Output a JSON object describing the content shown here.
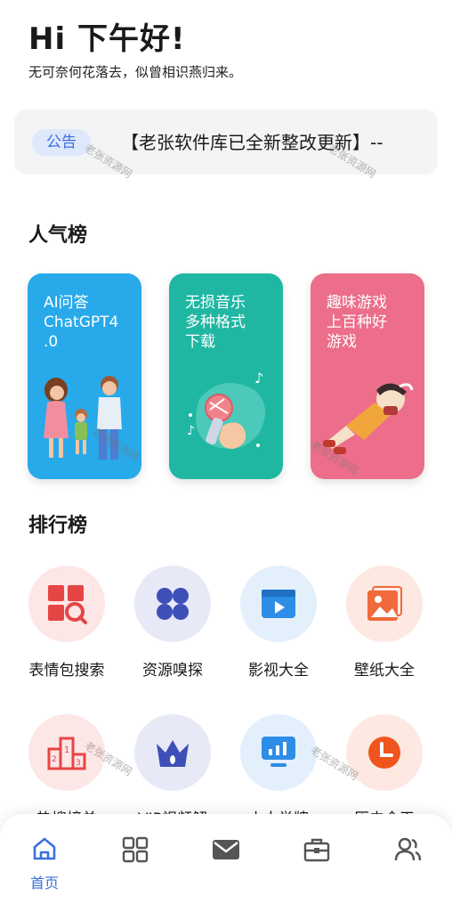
{
  "header": {
    "greeting": "Hi 下午好!",
    "subtitle": "无可奈何花落去，似曾相识燕归来。"
  },
  "notice": {
    "badge": "公告",
    "text": "【老张软件库已全新整改更新】--"
  },
  "popular": {
    "title": "人气榜",
    "cards": [
      {
        "label": "AI问答\nChatGPT4\n.0",
        "color": "#27a9ea"
      },
      {
        "label": "无损音乐\n多种格式\n下载",
        "color": "#20b7a2"
      },
      {
        "label": "趣味游戏\n上百种好\n游戏",
        "color": "#ec6e8a"
      }
    ]
  },
  "ranking": {
    "title": "排行榜",
    "items": [
      {
        "label": "表情包搜索",
        "icon": "emoji-search-icon",
        "bg": "#fde6e6"
      },
      {
        "label": "资源嗅探",
        "icon": "clover-icon",
        "bg": "#e8e9f7"
      },
      {
        "label": "影视大全",
        "icon": "video-icon",
        "bg": "#e3f0fc"
      },
      {
        "label": "壁纸大全",
        "icon": "image-icon",
        "bg": "#fde8e2"
      },
      {
        "label": "热搜榜单",
        "icon": "podium-icon",
        "bg": "#fde6e6"
      },
      {
        "label": "VIP视频解",
        "icon": "crown-icon",
        "bg": "#e8e9f7"
      },
      {
        "label": "小人举牌",
        "icon": "sign-board-icon",
        "bg": "#e3f0fc"
      },
      {
        "label": "历史今天",
        "icon": "clock-icon",
        "bg": "#fde8e2"
      }
    ]
  },
  "watermark": "老张资源网",
  "tabbar": {
    "active_label": "首页",
    "tabs": [
      "home-icon",
      "apps-icon",
      "mail-icon",
      "toolbox-icon",
      "users-icon"
    ],
    "active_color": "#3b6fe0",
    "inactive_color": "#555555"
  }
}
